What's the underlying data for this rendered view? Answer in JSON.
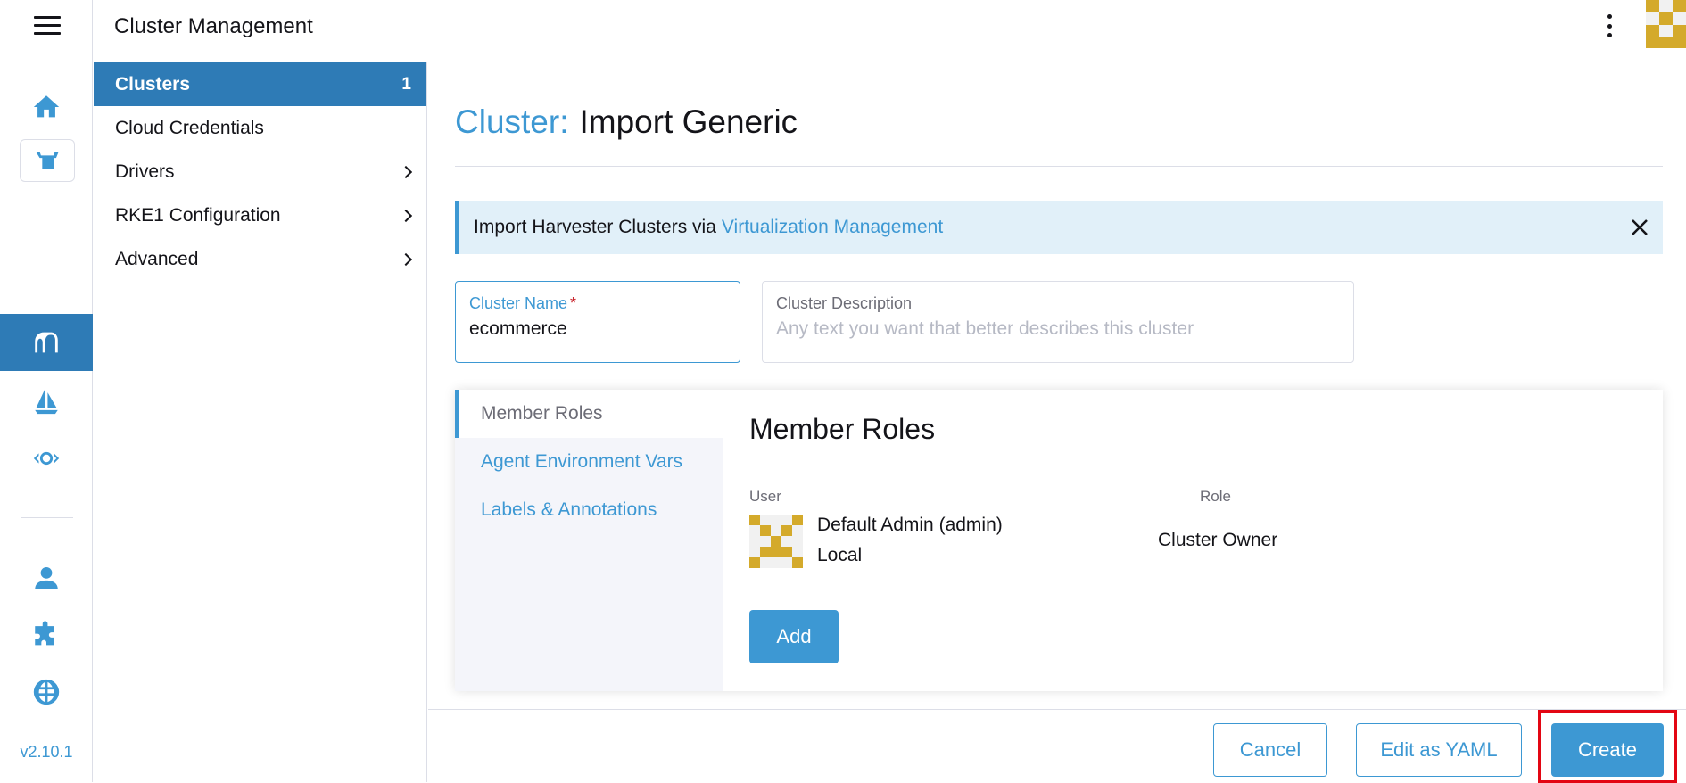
{
  "app": {
    "title": "Cluster Management",
    "version": "v2.10.1"
  },
  "rail": {
    "icons": [
      "menu-icon",
      "home-icon",
      "harvester-icon",
      "cluster-management-icon",
      "fleet-icon",
      "virtualization-icon",
      "user-icon",
      "extensions-icon",
      "globe-icon"
    ]
  },
  "sidebar": {
    "items": [
      {
        "label": "Clusters",
        "count": "1"
      },
      {
        "label": "Cloud Credentials"
      },
      {
        "label": "Drivers"
      },
      {
        "label": "RKE1 Configuration"
      },
      {
        "label": "Advanced"
      }
    ]
  },
  "page": {
    "title_label": "Cluster:",
    "title_value": "Import Generic"
  },
  "banner": {
    "text": "Import Harvester Clusters via",
    "link": "Virtualization Management"
  },
  "form": {
    "name": {
      "label": "Cluster Name",
      "required_mark": "*",
      "value": "ecommerce"
    },
    "description": {
      "label": "Cluster Description",
      "placeholder": "Any text you want that better describes this cluster",
      "value": ""
    }
  },
  "tabs": [
    {
      "label": "Member Roles"
    },
    {
      "label": "Agent Environment Vars"
    },
    {
      "label": "Labels & Annotations"
    }
  ],
  "member_roles": {
    "heading": "Member Roles",
    "columns": {
      "user": "User",
      "role": "Role"
    },
    "rows": [
      {
        "name": "Default Admin (admin)",
        "provider": "Local",
        "role": "Cluster Owner"
      }
    ],
    "add_label": "Add"
  },
  "footer": {
    "cancel": "Cancel",
    "edit_yaml": "Edit as YAML",
    "create": "Create"
  },
  "colors": {
    "accent": "#3d98d3",
    "active_nav": "#2e7bb6",
    "banner_bg": "#e1f0f9",
    "highlight": "#e30613",
    "avatar_gold": "#d4aa2b"
  }
}
